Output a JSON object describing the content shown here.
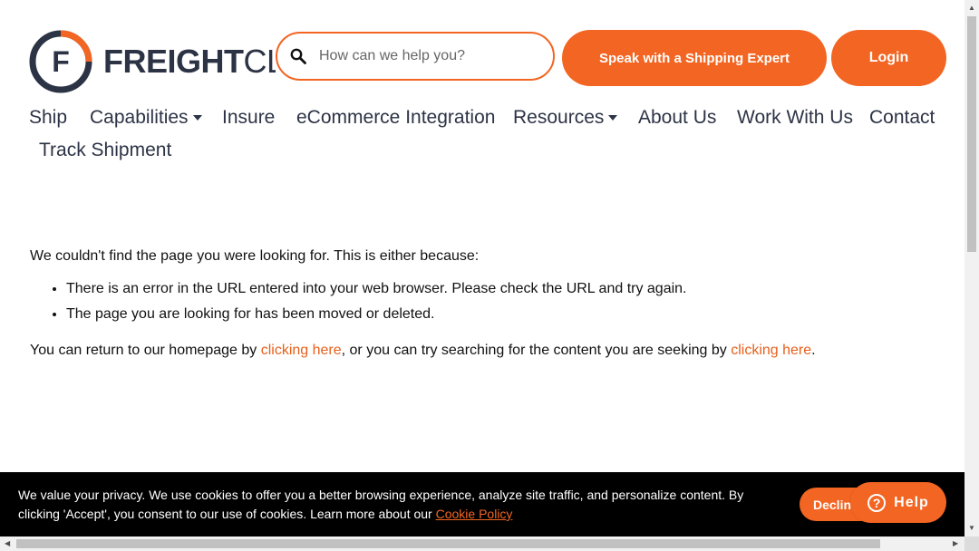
{
  "header": {
    "logo_text_bold": "FREIGHT",
    "logo_text_thin": "CL",
    "logo_letter": "F",
    "search": {
      "placeholder": "How can we help you?",
      "icon": "search-icon"
    },
    "expert_button": "Speak with a Shipping Expert",
    "login_button": "Login"
  },
  "nav": {
    "items": [
      {
        "label": "Ship"
      },
      {
        "label": "Capabilities",
        "dropdown": true
      },
      {
        "label": "Insure"
      },
      {
        "label": "eCommerce Integration"
      },
      {
        "label": "Resources",
        "dropdown": true
      },
      {
        "label": "About Us"
      },
      {
        "label": "Work With Us"
      },
      {
        "label": "Contact"
      },
      {
        "label": "Track Shipment"
      }
    ]
  },
  "content": {
    "intro": "We couldn't find the page you were looking for. This is either because:",
    "reasons": [
      "There is an error in the URL entered into your web browser. Please check the URL and try again.",
      "The page you are looking for has been moved or deleted."
    ],
    "return_prefix": "You can return to our homepage by ",
    "link_1": "clicking here",
    "return_middle": ", or you can try searching for the content you are seeking by ",
    "link_2": "clicking here",
    "return_suffix": "."
  },
  "cookie": {
    "message": "We value your privacy. We use cookies to offer you a better browsing experience, analyze site traffic, and personalize content. By clicking 'Accept', you consent to our use of cookies. Learn more about our ",
    "policy_link": "Cookie Policy",
    "decline_button": "Declin"
  },
  "help_button": {
    "label": "Help",
    "icon_glyph": "?"
  },
  "colors": {
    "accent": "#f26522",
    "navy": "#2c3345",
    "cookie_bg": "#000000"
  }
}
